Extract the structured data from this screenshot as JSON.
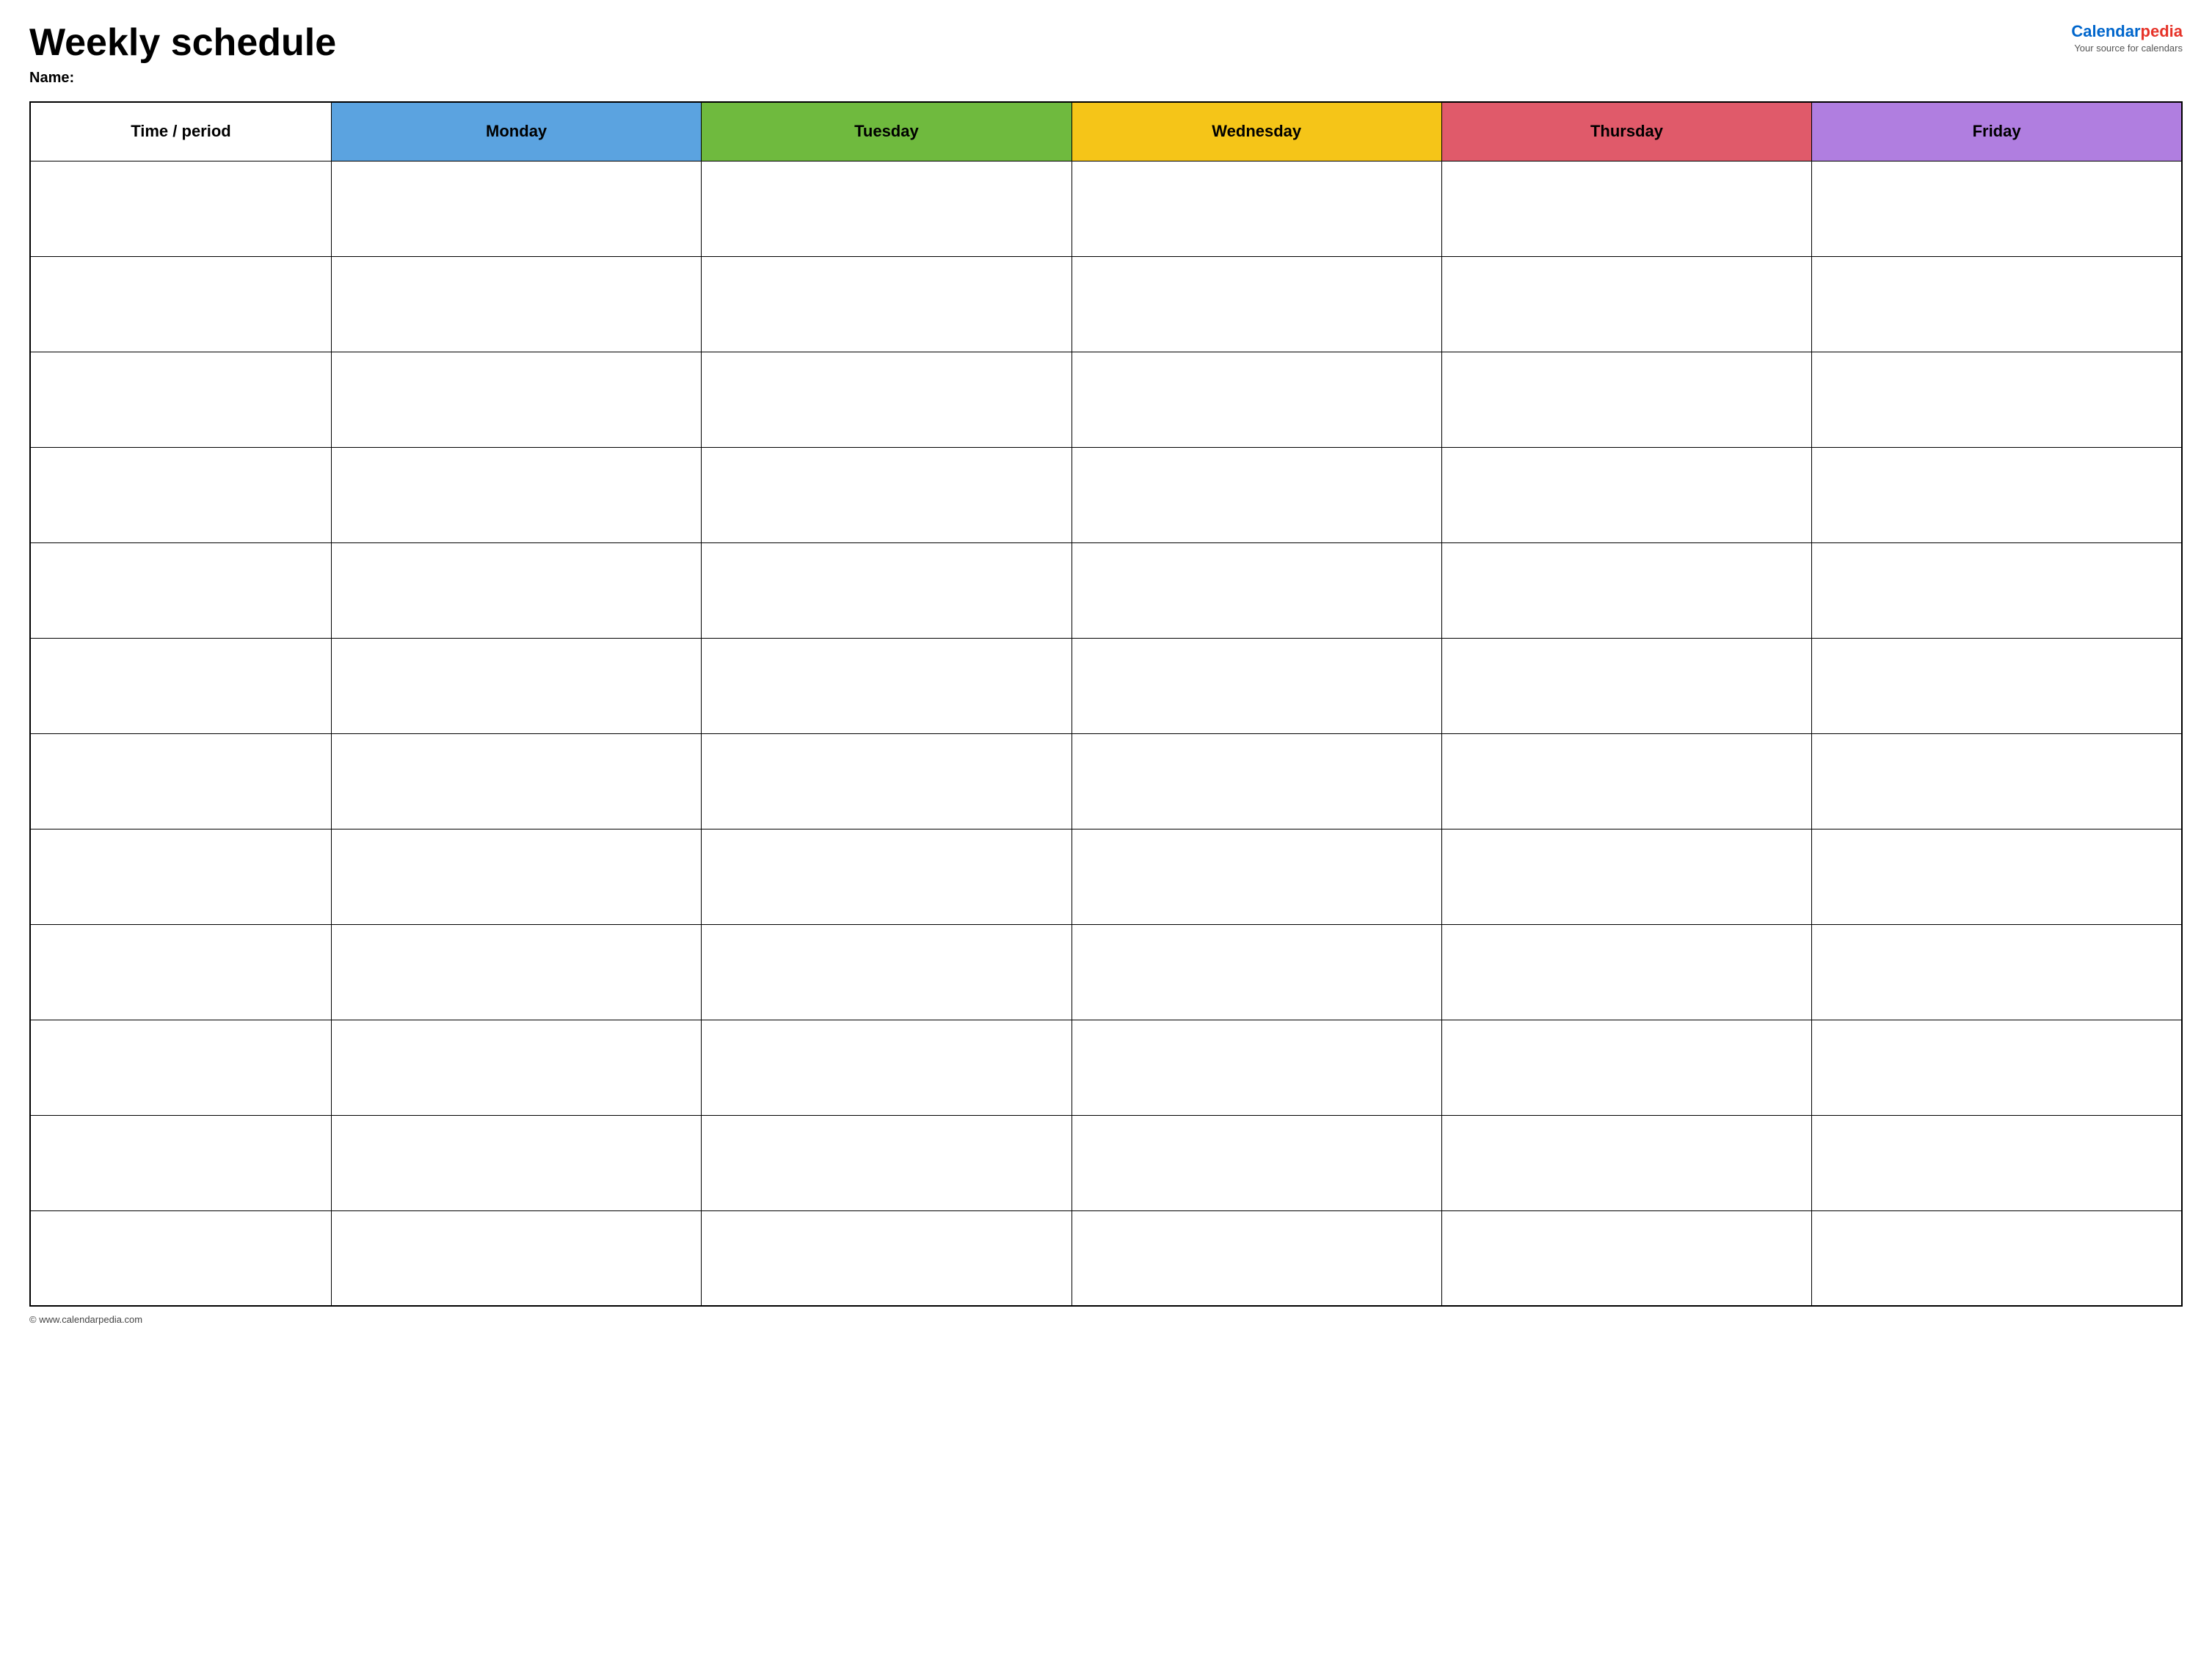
{
  "header": {
    "title": "Weekly schedule",
    "name_label": "Name:",
    "logo": {
      "brand_calendar": "Calendar",
      "brand_pedia": "pedia",
      "subtitle": "Your source for calendars"
    }
  },
  "table": {
    "columns": [
      {
        "id": "time",
        "label": "Time / period",
        "class": "th-time"
      },
      {
        "id": "monday",
        "label": "Monday",
        "class": "th-monday"
      },
      {
        "id": "tuesday",
        "label": "Tuesday",
        "class": "th-tuesday"
      },
      {
        "id": "wednesday",
        "label": "Wednesday",
        "class": "th-wednesday"
      },
      {
        "id": "thursday",
        "label": "Thursday",
        "class": "th-thursday"
      },
      {
        "id": "friday",
        "label": "Friday",
        "class": "th-friday"
      }
    ],
    "row_count": 12
  },
  "footer": {
    "copyright": "© www.calendarpedia.com"
  }
}
